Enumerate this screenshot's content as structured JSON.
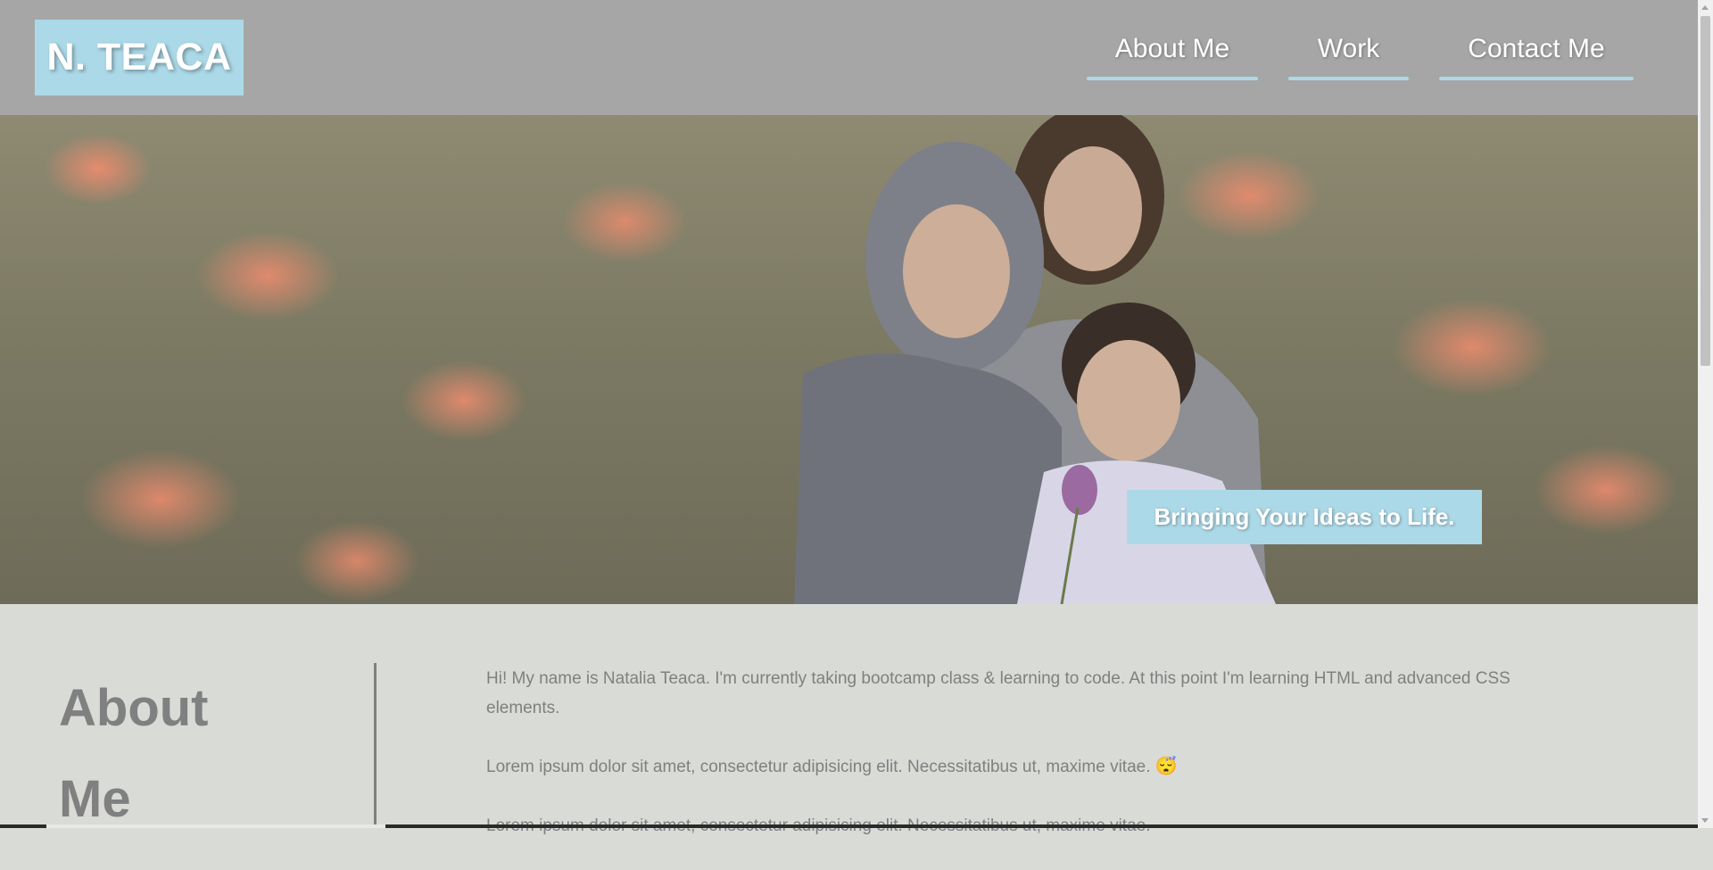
{
  "header": {
    "logo": "N. TEACA",
    "nav": [
      {
        "label": "About Me"
      },
      {
        "label": "Work"
      },
      {
        "label": "Contact Me"
      }
    ]
  },
  "hero": {
    "tagline": "Bringing Your Ideas to Life."
  },
  "about": {
    "title_line1": "About",
    "title_line2": "Me",
    "paragraphs": [
      "Hi! My name is Natalia Teaca. I'm currently taking bootcamp class & learning to code. At this point I'm learning HTML and advanced CSS elements.",
      "Lorem ipsum dolor sit amet, consectetur adipisicing elit. Necessitatibus ut, maxime vitae.",
      "Lorem ipsum dolor sit amet, consectetur adipisicing elit. Necessitatibus ut, maxime vitae."
    ],
    "emoji": "😴"
  },
  "colors": {
    "header_bg": "#a6a6a6",
    "accent": "#acd9e8",
    "section_bg": "#d9dbd7",
    "text_gray": "#808080"
  }
}
